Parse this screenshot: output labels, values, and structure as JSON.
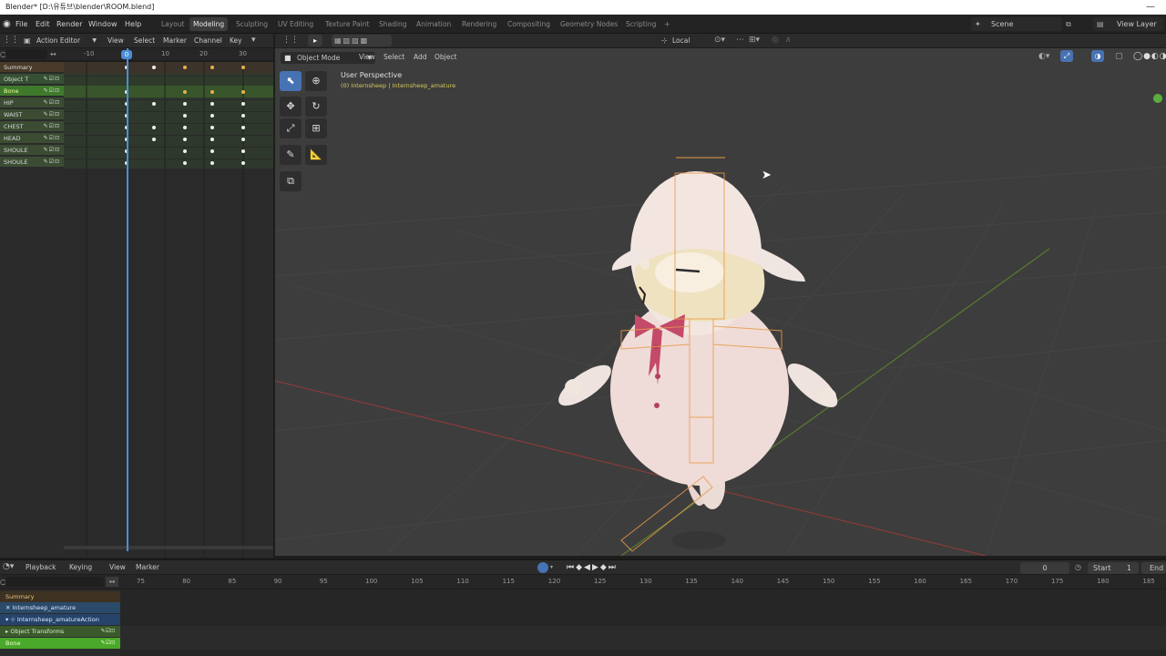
{
  "app": {
    "title": "Blender* [D:\\유튜브\\blender\\ROOM.blend]",
    "window_controls": "—"
  },
  "menu": {
    "file": "File",
    "edit": "Edit",
    "render": "Render",
    "window": "Window",
    "help": "Help"
  },
  "workspaces": [
    "Layout",
    "Modeling",
    "Sculpting",
    "UV Editing",
    "Texture Paint",
    "Shading",
    "Animation",
    "Rendering",
    "Compositing",
    "Geometry Nodes",
    "Scripting"
  ],
  "active_workspace": "Modeling",
  "add_workspace": "+",
  "scene": {
    "label": "Scene",
    "view_layer": "View Layer"
  },
  "action_editor": {
    "mode": "Action Editor",
    "menus": [
      "View",
      "Select",
      "Marker",
      "Channel",
      "Key"
    ],
    "ruler_ticks": [
      "-10",
      "0",
      "10",
      "20",
      "30"
    ],
    "current_frame": "0",
    "channels": [
      "Summary",
      "Object T",
      "Bone",
      "HIP",
      "WAIST",
      "CHEST",
      "HEAD",
      "SHOULE",
      "SHOULE"
    ]
  },
  "viewport": {
    "mode": "Object Mode",
    "menus": [
      "View",
      "Select",
      "Add",
      "Object"
    ],
    "transform_orientation": "Local",
    "perspective_label": "User Perspective",
    "object_label": "(0) Internsheep | Internsheep_amature"
  },
  "timeline": {
    "menus": [
      "Playback",
      "Keying",
      "View",
      "Marker"
    ],
    "ruler_ticks": [
      "75",
      "80",
      "85",
      "90",
      "95",
      "100",
      "105",
      "110",
      "115",
      "120",
      "125",
      "130",
      "135",
      "140",
      "145",
      "150",
      "155",
      "160",
      "165",
      "170",
      "175",
      "180",
      "185"
    ],
    "current_frame": "0",
    "start_label": "Start",
    "start_value": "1",
    "end_label": "End",
    "channels": [
      "Summary",
      "Internsheep_amature",
      "Internsheep_amatureAction",
      "Object Transforms",
      "Bone"
    ]
  },
  "colors": {
    "accent": "#4772b3",
    "keyframe": "#eeeeee",
    "selected_keyframe": "#e8b04a",
    "playhead": "#4a8ed8",
    "channel_green": "#3f7a2c"
  }
}
